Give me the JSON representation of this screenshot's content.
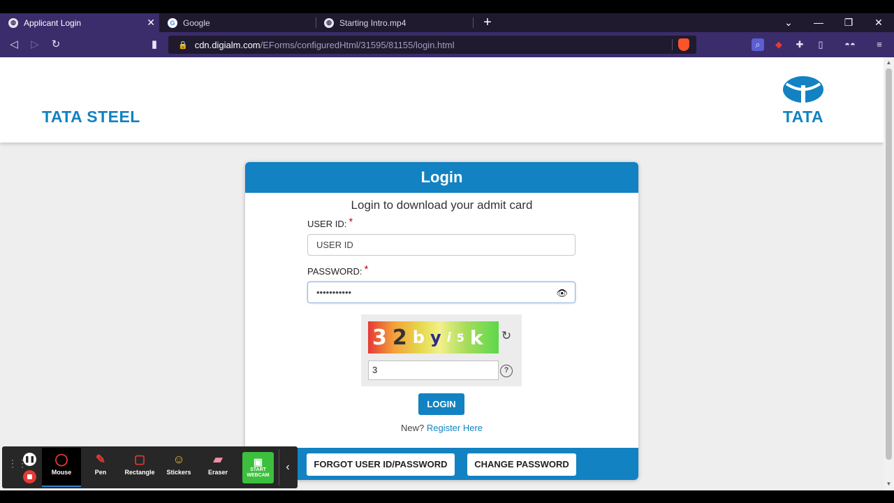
{
  "browser": {
    "tabs": [
      {
        "title": "Applicant Login",
        "active": true,
        "icon": "globe-icon"
      },
      {
        "title": "Google",
        "active": false,
        "icon": "google-icon"
      },
      {
        "title": "Starting Intro.mp4",
        "active": false,
        "icon": "globe-icon"
      }
    ],
    "newtab": "+",
    "url_host": "cdn.digialm.com",
    "url_path": "/EForms/configuredHtml/31595/81155/login.html"
  },
  "header": {
    "brand_left": "TATA STEEL",
    "brand_right": "TATA"
  },
  "login": {
    "title": "Login",
    "subtitle": "Login to download your admit card",
    "user_label": "USER ID:",
    "user_placeholder": "USER ID",
    "password_label": "PASSWORD:",
    "password_value": "•••••••••••",
    "required_mark": "*",
    "captcha_chars": [
      "3",
      "2",
      "b",
      "y",
      "i",
      "5",
      "k"
    ],
    "captcha_input": "3",
    "login_button": "LOGIN",
    "register_prefix": "New?",
    "register_link": "Register Here",
    "forgot_button": "FORGOT USER ID/PASSWORD",
    "change_button": "CHANGE PASSWORD"
  },
  "recorder": {
    "tools": [
      {
        "label": "Mouse",
        "icon": "mouse-icon",
        "active": true
      },
      {
        "label": "Pen",
        "icon": "pen-icon",
        "active": false
      },
      {
        "label": "Rectangle",
        "icon": "rectangle-icon",
        "active": false
      },
      {
        "label": "Stickers",
        "icon": "sticker-icon",
        "active": false
      },
      {
        "label": "Eraser",
        "icon": "eraser-icon",
        "active": false
      }
    ],
    "webcam_label": "START WEBCAM",
    "colors": {
      "webcam": "#3cbf3c",
      "stop": "#e53935"
    }
  },
  "colors": {
    "brand_blue": "#1282c2",
    "browser_purple": "#3b2c6b"
  }
}
